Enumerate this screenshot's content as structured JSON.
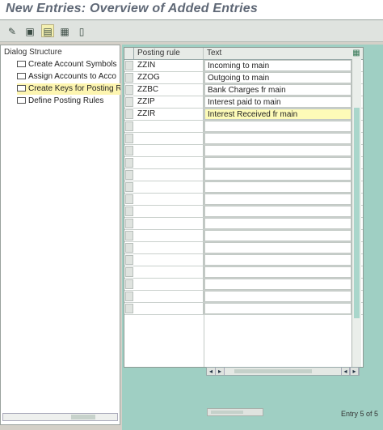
{
  "window": {
    "title": "New Entries: Overview of Added Entries"
  },
  "toolbar": {
    "buttons": [
      {
        "name": "change-display-icon",
        "glyph": "✎"
      },
      {
        "name": "save-icon",
        "glyph": "▣"
      },
      {
        "name": "select-all-icon",
        "glyph": "▤"
      },
      {
        "name": "select-block-icon",
        "glyph": "▦"
      },
      {
        "name": "deselect-all-icon",
        "glyph": "▯"
      }
    ]
  },
  "dialog_structure": {
    "heading": "Dialog Structure",
    "items": [
      {
        "label": "Create Account Symbols",
        "selected": false
      },
      {
        "label": "Assign Accounts to Acco",
        "selected": false
      },
      {
        "label": "Create Keys for Posting R",
        "selected": true
      },
      {
        "label": "Define Posting Rules",
        "selected": false
      }
    ]
  },
  "table": {
    "columns": [
      "Posting rule",
      "Text"
    ],
    "rows": [
      {
        "rule": "ZZIN",
        "text": "Incoming to main"
      },
      {
        "rule": "ZZOG",
        "text": "Outgoing to main"
      },
      {
        "rule": "ZZBC",
        "text": "Bank Charges fr main"
      },
      {
        "rule": "ZZIP",
        "text": "Interest paid to main"
      },
      {
        "rule": "ZZIR",
        "text": "Interest Received fr main",
        "highlighted": true
      }
    ],
    "empty_rows": 16
  },
  "status": {
    "entry": "Entry 5 of 5"
  },
  "colors": {
    "accent": "#9fcfc3",
    "highlight": "#fdfbb8"
  }
}
